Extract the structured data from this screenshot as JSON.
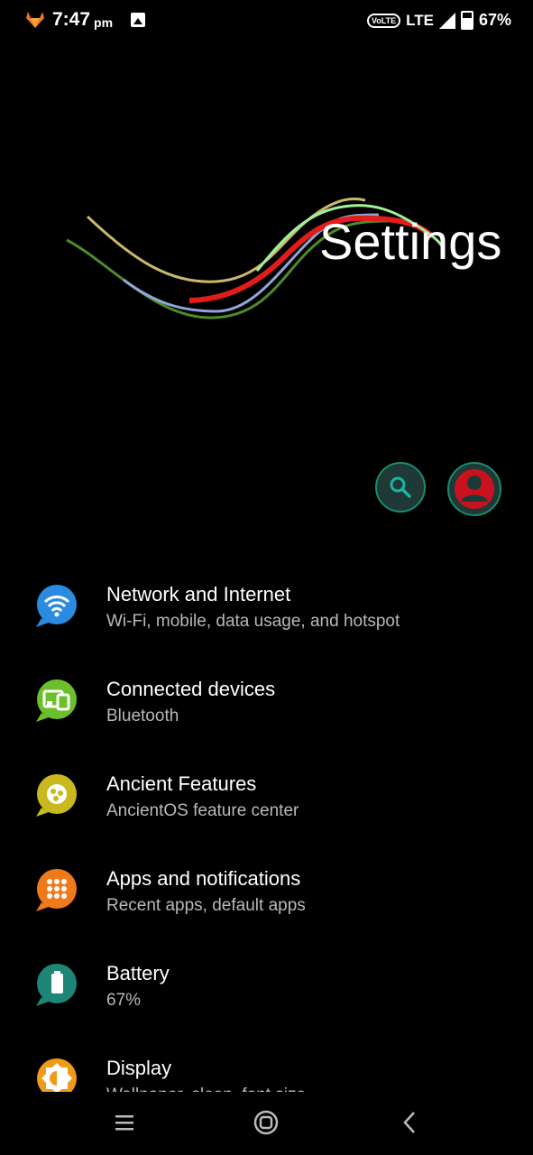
{
  "status_bar": {
    "time": "7:47",
    "ampm": "pm",
    "volte": "VoLTE",
    "network": "LTE",
    "battery": "67%"
  },
  "header": {
    "title": "Settings"
  },
  "actions": {
    "search_icon": "search-icon",
    "account_icon": "account-icon"
  },
  "settings": [
    {
      "title": "Network and Internet",
      "subtitle": "Wi-Fi, mobile, data usage, and hotspot",
      "icon": "wifi-icon",
      "color": "#2b8be0"
    },
    {
      "title": "Connected devices",
      "subtitle": "Bluetooth",
      "icon": "devices-icon",
      "color": "#6cbf2a"
    },
    {
      "title": "Ancient Features",
      "subtitle": "AncientOS feature center",
      "icon": "ancient-icon",
      "color": "#c9b81e"
    },
    {
      "title": "Apps and notifications",
      "subtitle": "Recent apps, default apps",
      "icon": "apps-grid-icon",
      "color": "#f07a1a"
    },
    {
      "title": "Battery",
      "subtitle": "67%",
      "icon": "battery-icon",
      "color": "#1e8577"
    },
    {
      "title": "Display",
      "subtitle": "Wallpaper, sleep, font size",
      "icon": "display-icon",
      "color": "#f09a1a"
    }
  ],
  "nav": {
    "menu": "menu-icon",
    "home": "home-icon",
    "back": "back-icon"
  }
}
